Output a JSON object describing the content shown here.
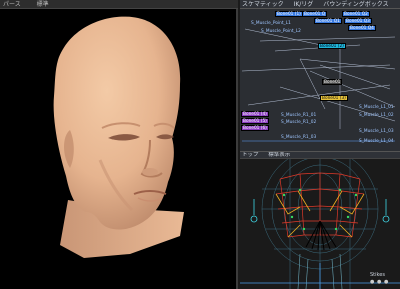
{
  "perspective_view": {
    "header_left": "パース",
    "header_mid": "標準"
  },
  "schematic": {
    "header_tabs": [
      "スケマティック",
      "IK/リグ",
      "バウンディングボックス"
    ],
    "nodes": [
      "Bone01 (1)",
      "Bone01 Q",
      "Bone01 Q2",
      "Bone01 Q1",
      "Bone01 Q3",
      "Bone01 Q4",
      "S_Muscle_Point_L1",
      "S_Muscle_Point_L2",
      "Bone01 (2)",
      "Bone01",
      "Bone01 (3)",
      "Bone01 (4)",
      "Bone01 (5)",
      "Bone01 (6)",
      "S_Muscle_R1_01",
      "S_Muscle_R1_02",
      "S_Muscle_R1_03",
      "S_Muscle_L1_01",
      "S_Muscle_L1_02",
      "S_Muscle_L1_03",
      "S_Muscle_L1_04"
    ]
  },
  "mesh_view": {
    "header_left": "トップ",
    "header_mid": "標準表示",
    "corner_label": "Stikes",
    "corner_icons": [
      "●",
      "●",
      "●"
    ]
  },
  "colors": {
    "skin": "#e8b894",
    "bg_black": "#000000",
    "panel_bg": "#2b2e33",
    "node_blue": "#3a7be0",
    "node_cyan": "#1fb5d8",
    "node_yellow": "#e6c23a"
  }
}
